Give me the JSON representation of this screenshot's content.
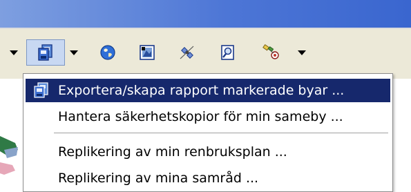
{
  "menu": {
    "items": [
      {
        "label": "Exportera/skapa rapport markerade byar ...",
        "highlighted": true
      },
      {
        "label": "Hantera säkerhetskopior för min sameby ...",
        "highlighted": false
      },
      {
        "label": "Replikering av min renbruksplan ...",
        "highlighted": false
      },
      {
        "label": "Replikering av mina samråd ...",
        "highlighted": false
      }
    ]
  },
  "toolbar": {
    "buttons": [
      "dropdown-arrow-icon",
      "export-report-icon",
      "dropdown-arrow-icon",
      "globe-icon",
      "map-image-icon",
      "satellite-tool-icon",
      "zoom-page-icon",
      "gps-satellite-icon",
      "dropdown-arrow-icon"
    ]
  },
  "colors": {
    "title_bar": "#4d76d6",
    "toolbar_bg": "#ece9d8",
    "menu_highlight": "#16286c",
    "active_button_bg": "#c8d8f2"
  }
}
